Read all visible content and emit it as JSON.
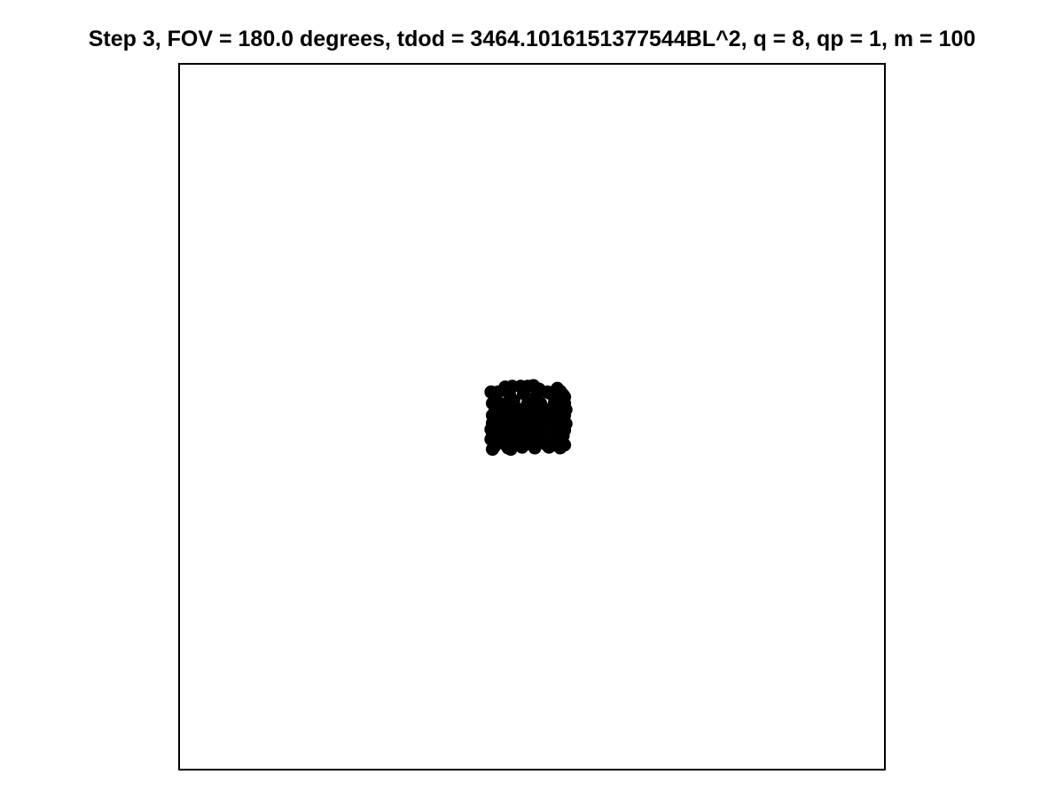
{
  "chart_data": {
    "type": "scatter",
    "title": "Step 3, FOV = 180.0 degrees, tdod = 3464.1016151377544BL^2, q = 8, qp = 1, m = 100",
    "xlabel": "",
    "ylabel": "",
    "xlim": [
      -50,
      50
    ],
    "ylim": [
      -50,
      50
    ],
    "axes_visible": false,
    "grid": false,
    "marker_color": "#000000",
    "series": [
      {
        "x": [
          -5.8,
          -3.8,
          -2.8,
          -1.6,
          -0.6,
          0.2,
          1.0,
          2.2,
          3.6,
          4.0,
          4.4,
          -4.8,
          -3.2,
          -1.2,
          0.6,
          2.6,
          4.6,
          -5.6,
          -4.4,
          -2.6,
          -0.6,
          1.2,
          3.2,
          4.6,
          -5.2,
          -3.6,
          -2.2,
          0.2,
          2.0,
          3.4,
          4.8,
          -5.6,
          -4.4,
          -3.0,
          -1.2,
          0.8,
          2.6,
          4.6,
          -4.6,
          -3.2,
          -1.6,
          0.0,
          1.8,
          3.6,
          -5.6,
          -4.6,
          -3.6,
          -2.2,
          -0.4,
          2.2,
          3.6,
          4.8,
          -5.8,
          -4.6,
          -3.4,
          -2.0,
          -0.4,
          1.2,
          3.0,
          4.6,
          -5.6,
          -4.2,
          -2.6,
          -0.8,
          1.0,
          2.8,
          4.4,
          -5.8,
          -5.0,
          -3.8,
          -2.2,
          -0.6,
          1.4,
          3.4,
          -5.2,
          -3.8,
          -1.8,
          0.2,
          2.0,
          3.8,
          -5.4,
          -3.4,
          -1.4,
          0.4,
          2.4,
          4.0,
          -5.6,
          -3.0,
          -1.6,
          -0.4,
          2.4,
          4.6,
          -2.6,
          -1.0,
          0.8,
          -3.6,
          -1.8,
          0.2
        ],
        "y": [
          3.5,
          4.2,
          4.3,
          4.3,
          4.3,
          4.4,
          3.9,
          3.5,
          4.0,
          3.6,
          3.1,
          3.5,
          3.2,
          3.3,
          2.9,
          3.3,
          2.8,
          1.9,
          1.8,
          2.3,
          1.9,
          1.9,
          2.0,
          1.9,
          1.0,
          1.5,
          1.2,
          1.3,
          1.0,
          1.3,
          1.0,
          0.2,
          0.6,
          0.3,
          0.6,
          0.2,
          0.3,
          0.2,
          -0.4,
          -0.2,
          -0.5,
          -0.3,
          -0.5,
          -0.2,
          -0.9,
          -1.1,
          -0.9,
          -1.2,
          -1.1,
          -1.0,
          -0.9,
          -1.0,
          -1.8,
          -1.7,
          -1.9,
          -2.1,
          -2.0,
          -1.7,
          -1.7,
          -1.9,
          -2.6,
          -2.6,
          -2.8,
          -2.5,
          -2.7,
          -2.6,
          -2.7,
          -3.2,
          -3.5,
          -3.4,
          -3.3,
          -3.4,
          -3.3,
          -3.4,
          -3.9,
          -3.9,
          -4.0,
          -4.1,
          -3.9,
          -4.2,
          -4.3,
          -4.4,
          -4.3,
          -4.4,
          -4.3,
          -4.4,
          -4.6,
          -4.6,
          -3.6,
          -3.6,
          -4.1,
          -4.0,
          -0.6,
          -1.4,
          -1.4,
          0.7,
          -0.1,
          0.9
        ]
      }
    ]
  }
}
